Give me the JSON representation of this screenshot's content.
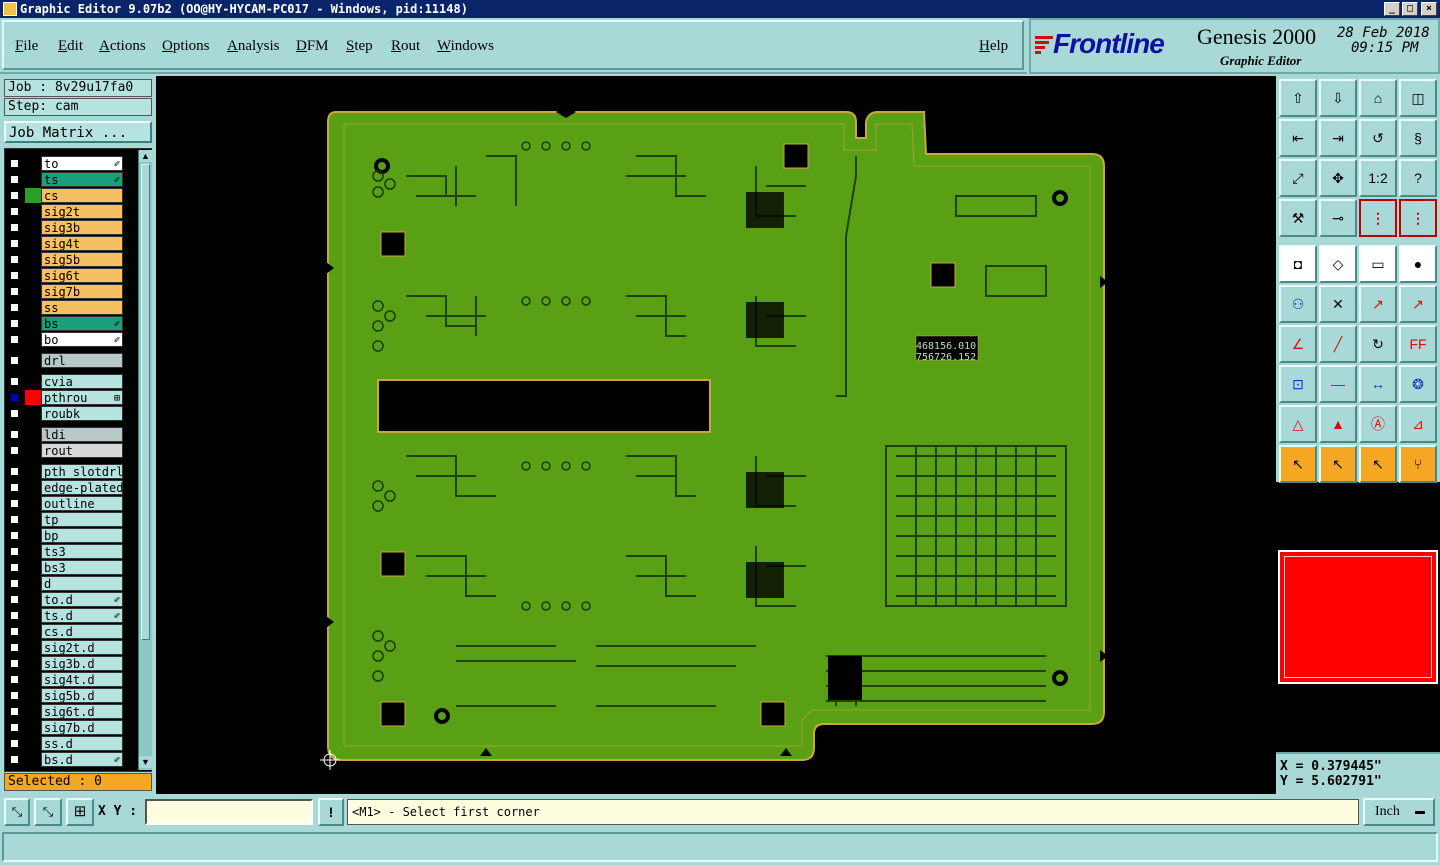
{
  "window": {
    "title": "Graphic Editor 9.07b2 (OO@HY-HYCAM-PC017 - Windows, pid:11148)",
    "controls": [
      "_",
      "□",
      "×"
    ]
  },
  "menu": [
    "File",
    "Edit",
    "Actions",
    "Options",
    "Analysis",
    "DFM",
    "Step",
    "Rout",
    "Windows"
  ],
  "help_label": "Help",
  "brand": {
    "logo": "Frontline",
    "product": "Genesis 2000",
    "subtitle": "Graphic Editor",
    "date": "28 Feb 2018",
    "time": "09:15 PM"
  },
  "job": {
    "job_label": "Job : 8v29u17fa0",
    "step_label": "Step: cam",
    "matrix_button": "Job Matrix ..."
  },
  "layers_group1": [
    {
      "name": "to",
      "bg": "#ffffff",
      "color": "#000000",
      "mark": "✐"
    },
    {
      "name": "ts",
      "bg": "#1aa07a",
      "color": "#000000",
      "mark": "✐"
    },
    {
      "name": "cs",
      "bg": "#f5c060",
      "color": "#2aa02a",
      "mark": ""
    },
    {
      "name": "sig2t",
      "bg": "#f5c060",
      "color": "#000000",
      "mark": ""
    },
    {
      "name": "sig3b",
      "bg": "#f5c060",
      "color": "#000000",
      "mark": ""
    },
    {
      "name": "sig4t",
      "bg": "#f5c060",
      "color": "#000000",
      "mark": ""
    },
    {
      "name": "sig5b",
      "bg": "#f5c060",
      "color": "#000000",
      "mark": ""
    },
    {
      "name": "sig6t",
      "bg": "#f5c060",
      "color": "#000000",
      "mark": ""
    },
    {
      "name": "sig7b",
      "bg": "#f5c060",
      "color": "#000000",
      "mark": ""
    },
    {
      "name": "ss",
      "bg": "#f5c060",
      "color": "#000000",
      "mark": ""
    },
    {
      "name": "bs",
      "bg": "#1aa07a",
      "color": "#000000",
      "mark": "✐"
    },
    {
      "name": "bo",
      "bg": "#ffffff",
      "color": "#000000",
      "mark": "✐"
    }
  ],
  "layers_group2": [
    {
      "name": "drl",
      "bg": "#b8c8c8",
      "color": "#000000",
      "mark": ""
    }
  ],
  "layers_group3": [
    {
      "name": "cvia",
      "bg": "#b5e3e0",
      "color": "#000000",
      "mark": ""
    },
    {
      "name": "pthrou",
      "bg": "#b5e3e0",
      "color": "#ff0000",
      "mark": "⊞"
    },
    {
      "name": "roubk",
      "bg": "#b5e3e0",
      "color": "#000000",
      "mark": ""
    }
  ],
  "layers_group4": [
    {
      "name": "ldi",
      "bg": "#b8c8c8",
      "color": "#000000",
      "mark": ""
    },
    {
      "name": "rout",
      "bg": "#d8d8d8",
      "color": "#000000",
      "mark": ""
    }
  ],
  "layers_group5": [
    {
      "name": "pth_slotdrl",
      "bg": "#b5e3e0",
      "color": "#000000",
      "mark": ""
    },
    {
      "name": "edge-plated",
      "bg": "#b5e3e0",
      "color": "#000000",
      "mark": ""
    },
    {
      "name": "outline",
      "bg": "#b5e3e0",
      "color": "#000000",
      "mark": ""
    },
    {
      "name": "tp",
      "bg": "#b5e3e0",
      "color": "#000000",
      "mark": ""
    },
    {
      "name": "bp",
      "bg": "#b5e3e0",
      "color": "#000000",
      "mark": ""
    },
    {
      "name": "ts3",
      "bg": "#b5e3e0",
      "color": "#000000",
      "mark": ""
    },
    {
      "name": "bs3",
      "bg": "#b5e3e0",
      "color": "#000000",
      "mark": ""
    },
    {
      "name": "d",
      "bg": "#b5e3e0",
      "color": "#000000",
      "mark": ""
    },
    {
      "name": "to.d",
      "bg": "#b5e3e0",
      "color": "#000000",
      "mark": "✐"
    },
    {
      "name": "ts.d",
      "bg": "#b5e3e0",
      "color": "#000000",
      "mark": "✐"
    },
    {
      "name": "cs.d",
      "bg": "#b5e3e0",
      "color": "#000000",
      "mark": ""
    },
    {
      "name": "sig2t.d",
      "bg": "#b5e3e0",
      "color": "#000000",
      "mark": ""
    },
    {
      "name": "sig3b.d",
      "bg": "#b5e3e0",
      "color": "#000000",
      "mark": ""
    },
    {
      "name": "sig4t.d",
      "bg": "#b5e3e0",
      "color": "#000000",
      "mark": ""
    },
    {
      "name": "sig5b.d",
      "bg": "#b5e3e0",
      "color": "#000000",
      "mark": ""
    },
    {
      "name": "sig6t.d",
      "bg": "#b5e3e0",
      "color": "#000000",
      "mark": ""
    },
    {
      "name": "sig7b.d",
      "bg": "#b5e3e0",
      "color": "#000000",
      "mark": ""
    },
    {
      "name": "ss.d",
      "bg": "#b5e3e0",
      "color": "#000000",
      "mark": ""
    },
    {
      "name": "bs.d",
      "bg": "#b5e3e0",
      "color": "#000000",
      "mark": "✐"
    }
  ],
  "selected_label": "Selected : 0",
  "board_text": [
    "468156.010",
    "756726.152"
  ],
  "coords": {
    "x": "X = 0.379445\"",
    "y": "Y = 5.602791\""
  },
  "statusbar": {
    "xy_label": "X Y :",
    "xy_value": "",
    "prompt": "<M1> - Select first corner",
    "units": "Inch"
  },
  "colors": {
    "board": "#5aa014",
    "panel": "#a9d9d6",
    "active_layer": "#ff0000",
    "title_bg": "#0a246a"
  },
  "tools": [
    [
      "export-icon",
      "import-icon",
      "home-icon",
      "split-view-icon"
    ],
    [
      "zoom-left-icon",
      "zoom-right-icon",
      "rotate-icon",
      "flip-icon"
    ],
    [
      "fit-icon",
      "center-icon",
      "scale-1-2-icon",
      "question-icon"
    ],
    [
      "tools-icon",
      "probe-icon",
      "layers-a-icon",
      "layers-b-icon"
    ],
    [
      "snap-icon",
      "rect-select-icon",
      "ruler-icon",
      "pad-icon"
    ],
    [
      "graph-icon",
      "cross-icon",
      "measure-point-icon",
      "measure-dist-icon"
    ],
    [
      "angle-icon",
      "line-icon",
      "arc-icon",
      "ff-icon"
    ],
    [
      "pads-icon",
      "minus-icon",
      "dim-icon",
      "circles-icon"
    ],
    [
      "tri-a-icon",
      "tri-b-icon",
      "tri-c-icon",
      "tri-d-icon"
    ],
    [
      "pointer-icon",
      "pointer-box-icon",
      "pointer-select-icon",
      "route-icon"
    ]
  ]
}
